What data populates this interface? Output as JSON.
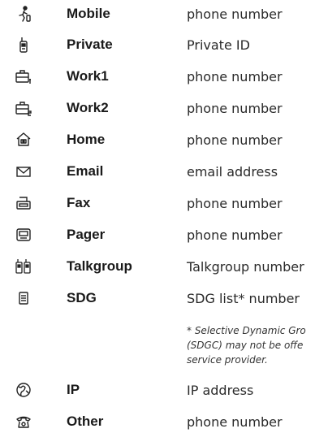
{
  "rows": [
    {
      "type": "Mobile",
      "value": "phone number",
      "icon": "mobile-person-icon"
    },
    {
      "type": "Private",
      "value": "Private ID",
      "icon": "private-radio-icon"
    },
    {
      "type": "Work1",
      "value": "phone number",
      "icon": "work1-briefcase-icon"
    },
    {
      "type": "Work2",
      "value": "phone number",
      "icon": "work2-briefcase-icon"
    },
    {
      "type": "Home",
      "value": "phone number",
      "icon": "home-icon"
    },
    {
      "type": "Email",
      "value": "email address",
      "icon": "envelope-icon"
    },
    {
      "type": "Fax",
      "value": "phone number",
      "icon": "fax-icon"
    },
    {
      "type": "Pager",
      "value": "phone number",
      "icon": "pager-icon"
    },
    {
      "type": "Talkgroup",
      "value": "Talkgroup number",
      "icon": "talkgroup-radios-icon"
    },
    {
      "type": "SDG",
      "value": "SDG list* number",
      "icon": "sdg-list-icon"
    },
    {
      "type": "IP",
      "value": "IP address",
      "icon": "globe-icon"
    },
    {
      "type": "Other",
      "value": "phone number",
      "icon": "telephone-icon"
    }
  ],
  "footnote": {
    "line1": "* Selective Dynamic Gro",
    "line2": "(SDGC) may not be offe",
    "line3": "service provider."
  }
}
